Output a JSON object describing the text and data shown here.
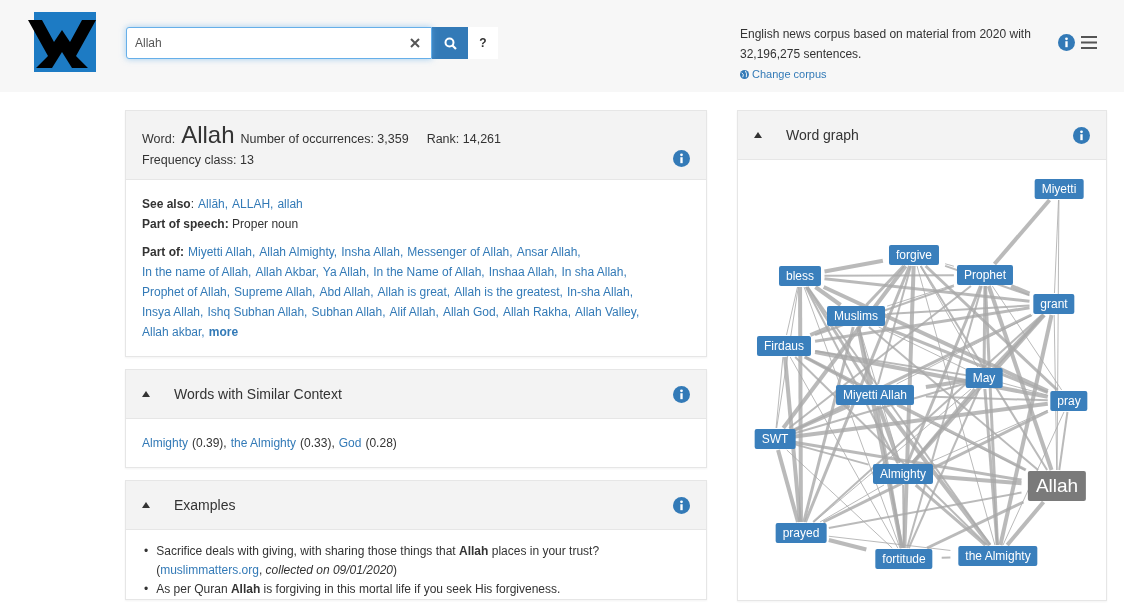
{
  "header": {
    "search": {
      "value": "Allah"
    },
    "help": "?",
    "corpus": {
      "description": "English news corpus based on material from 2020 with 32,196,275 sentences.",
      "change_link": "Change corpus"
    }
  },
  "word_card": {
    "word_label": "Word:",
    "word": "Allah",
    "occurrences": "Number of occurrences: 3,359",
    "rank": "Rank: 14,261",
    "frequency_class": "Frequency class: 13",
    "see_also_label": "**See also**:",
    "see_also": [
      "Allāh,",
      "ALLAH,",
      "allah"
    ],
    "pos": "**Part of speech:** Proper noun",
    "part_of_label": "Part of:",
    "part_of": [
      "Miyetti Allah,",
      "Allah Almighty,",
      "Insha Allah,",
      "Messenger of Allah,",
      "Ansar Allah,",
      "In the name of Allah,",
      "Allah Akbar,",
      "Ya Allah,",
      "In the Name of Allah,",
      "Inshaa Allah,",
      "In sha Allah,",
      "Prophet of Allah,",
      "Supreme Allah,",
      "Abd Allah,",
      "Allah is great,",
      "Allah is the greatest,",
      "In-sha Allah,",
      "Insya Allah,",
      "Ishq Subhan Allah,",
      "Subhan Allah,",
      "Alif Allah,",
      "Allah God,",
      "Allah Rakha,",
      "Allah Valley,",
      "Allah akbar,"
    ],
    "more": "more"
  },
  "similar": {
    "title": "Words with Similar Context",
    "expanded": true,
    "items": [
      {
        "word": "Almighty",
        "score": "(0.39),"
      },
      {
        "word": "the Almighty",
        "score": "(0.33),"
      },
      {
        "word": "God",
        "score": "(0.28)"
      }
    ]
  },
  "examples": {
    "title": "Examples",
    "expanded": true,
    "items": [
      {
        "bullet": "•",
        "text": "Sacrifice deals with giving, with sharing those things that **Allah** places in your trust?",
        "open": "(",
        "source": "muslimmatters.org",
        "rest": ", *collected on 09/01/2020*)"
      },
      {
        "bullet": "•",
        "text": "As per Quran **Allah** is forgiving in this mortal life if you seek His forgiveness."
      }
    ]
  },
  "word_graph": {
    "title": "Word graph",
    "expanded": true,
    "nodes": [
      {
        "label": "Miyetti",
        "kind": "word"
      },
      {
        "label": "forgive",
        "kind": "word"
      },
      {
        "label": "bless",
        "kind": "word"
      },
      {
        "label": "Prophet",
        "kind": "word"
      },
      {
        "label": "grant",
        "kind": "word"
      },
      {
        "label": "Muslims",
        "kind": "word"
      },
      {
        "label": "Firdaus",
        "kind": "word"
      },
      {
        "label": "May",
        "kind": "word"
      },
      {
        "label": "Miyetti Allah",
        "kind": "word"
      },
      {
        "label": "pray",
        "kind": "word"
      },
      {
        "label": "SWT",
        "kind": "word"
      },
      {
        "label": "Almighty",
        "kind": "word"
      },
      {
        "label": "Allah",
        "kind": "center"
      },
      {
        "label": "prayed",
        "kind": "word"
      },
      {
        "label": "fortitude",
        "kind": "word"
      },
      {
        "label": "the Almighty",
        "kind": "word"
      }
    ]
  }
}
